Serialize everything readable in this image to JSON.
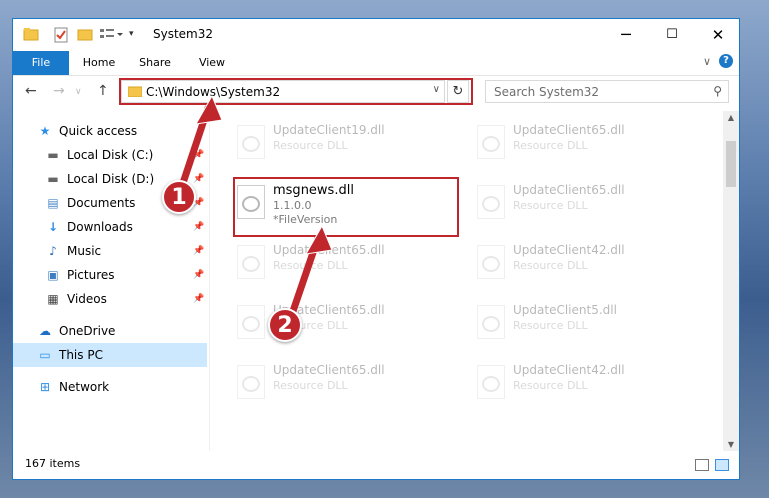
{
  "window": {
    "title": "System32"
  },
  "ribbon": {
    "tabs": [
      "File",
      "Home",
      "Share",
      "View"
    ]
  },
  "address": {
    "path": "C:\\Windows\\System32"
  },
  "search": {
    "placeholder": "Search System32"
  },
  "sidebar": {
    "items": [
      {
        "label": "Quick access",
        "icon": "star-icon"
      },
      {
        "label": "Local Disk (C:)",
        "icon": "drive-icon"
      },
      {
        "label": "Local Disk (D:)",
        "icon": "drive-icon"
      },
      {
        "label": "Documents",
        "icon": "documents-icon"
      },
      {
        "label": "Downloads",
        "icon": "downloads-icon"
      },
      {
        "label": "Music",
        "icon": "music-icon"
      },
      {
        "label": "Pictures",
        "icon": "pictures-icon"
      },
      {
        "label": "Videos",
        "icon": "videos-icon"
      },
      {
        "label": "OneDrive",
        "icon": "cloud-icon"
      },
      {
        "label": "This PC",
        "icon": "computer-icon"
      },
      {
        "label": "Network",
        "icon": "network-icon"
      }
    ]
  },
  "files": {
    "focus": {
      "name": "msgnews.dll",
      "version": "1.1.0.0",
      "desc": "*FileVersion"
    },
    "ghosts": [
      {
        "name": "UpdateClient19.dll",
        "type": "Resource DLL"
      },
      {
        "name": "UpdateClient65.dll",
        "type": "Resource DLL"
      },
      {
        "name": "UpdateClient65.dll",
        "type": "Resource DLL"
      },
      {
        "name": "UpdateClient65.dll",
        "type": "Resource DLL"
      },
      {
        "name": "UpdateClient42.dll",
        "type": "Resource DLL"
      },
      {
        "name": "UpdateClient65.dll",
        "type": "Resource DLL"
      },
      {
        "name": "UpdateClient5.dll",
        "type": "Resource DLL"
      },
      {
        "name": "UpdateClient65.dll",
        "type": "Resource DLL"
      },
      {
        "name": "UpdateClient42.dll",
        "type": "Resource DLL"
      }
    ]
  },
  "status": {
    "count": "167 items"
  },
  "annotations": {
    "step1": "1",
    "step2": "2"
  },
  "colors": {
    "accent": "#1979ca",
    "highlight": "#c0272d",
    "selected": "#cce8ff"
  }
}
